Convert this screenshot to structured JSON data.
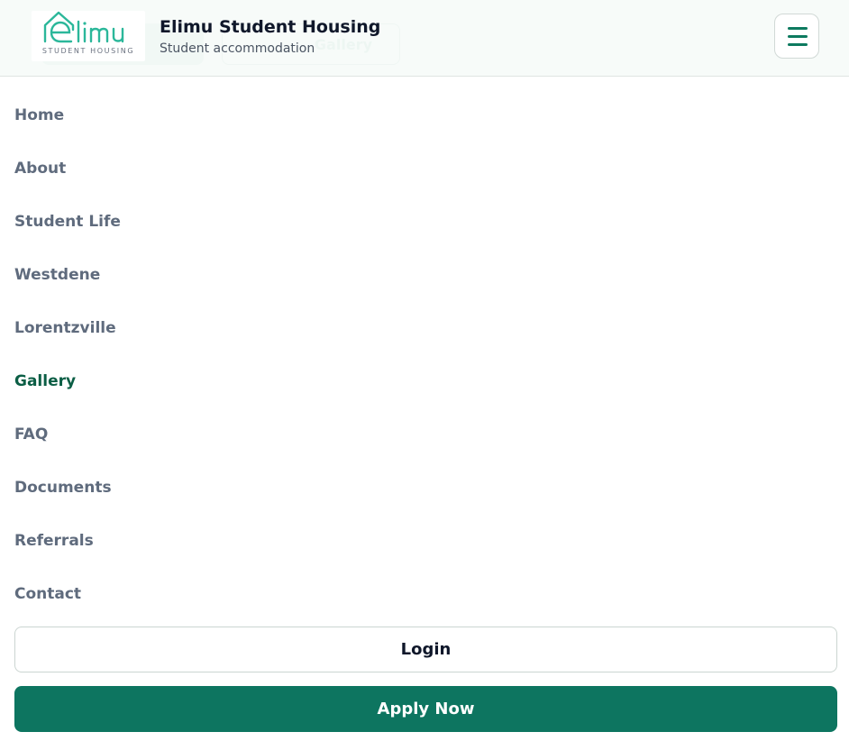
{
  "colors": {
    "brand": "#0d7560",
    "active_nav": "#0b5e45",
    "nav_text": "#5f6b7d",
    "logo_accent": "#2bb79a"
  },
  "background": {
    "secondary_button_label": "Gallery"
  },
  "header": {
    "logo": {
      "text": "elimu",
      "subtitle": "STUDENT HOUSING",
      "icon": "house-icon"
    },
    "title": "Elimu Student Housing",
    "tagline": "Student accommodation",
    "menu_icon": "hamburger-menu-icon"
  },
  "nav": {
    "items": [
      {
        "label": "Home",
        "active": false
      },
      {
        "label": "About",
        "active": false
      },
      {
        "label": "Student Life",
        "active": false
      },
      {
        "label": "Westdene",
        "active": false
      },
      {
        "label": "Lorentzville",
        "active": false
      },
      {
        "label": "Gallery",
        "active": true
      },
      {
        "label": "FAQ",
        "active": false
      },
      {
        "label": "Documents",
        "active": false
      },
      {
        "label": "Referrals",
        "active": false
      },
      {
        "label": "Contact",
        "active": false
      }
    ]
  },
  "actions": {
    "login_label": "Login",
    "apply_label": "Apply Now"
  }
}
